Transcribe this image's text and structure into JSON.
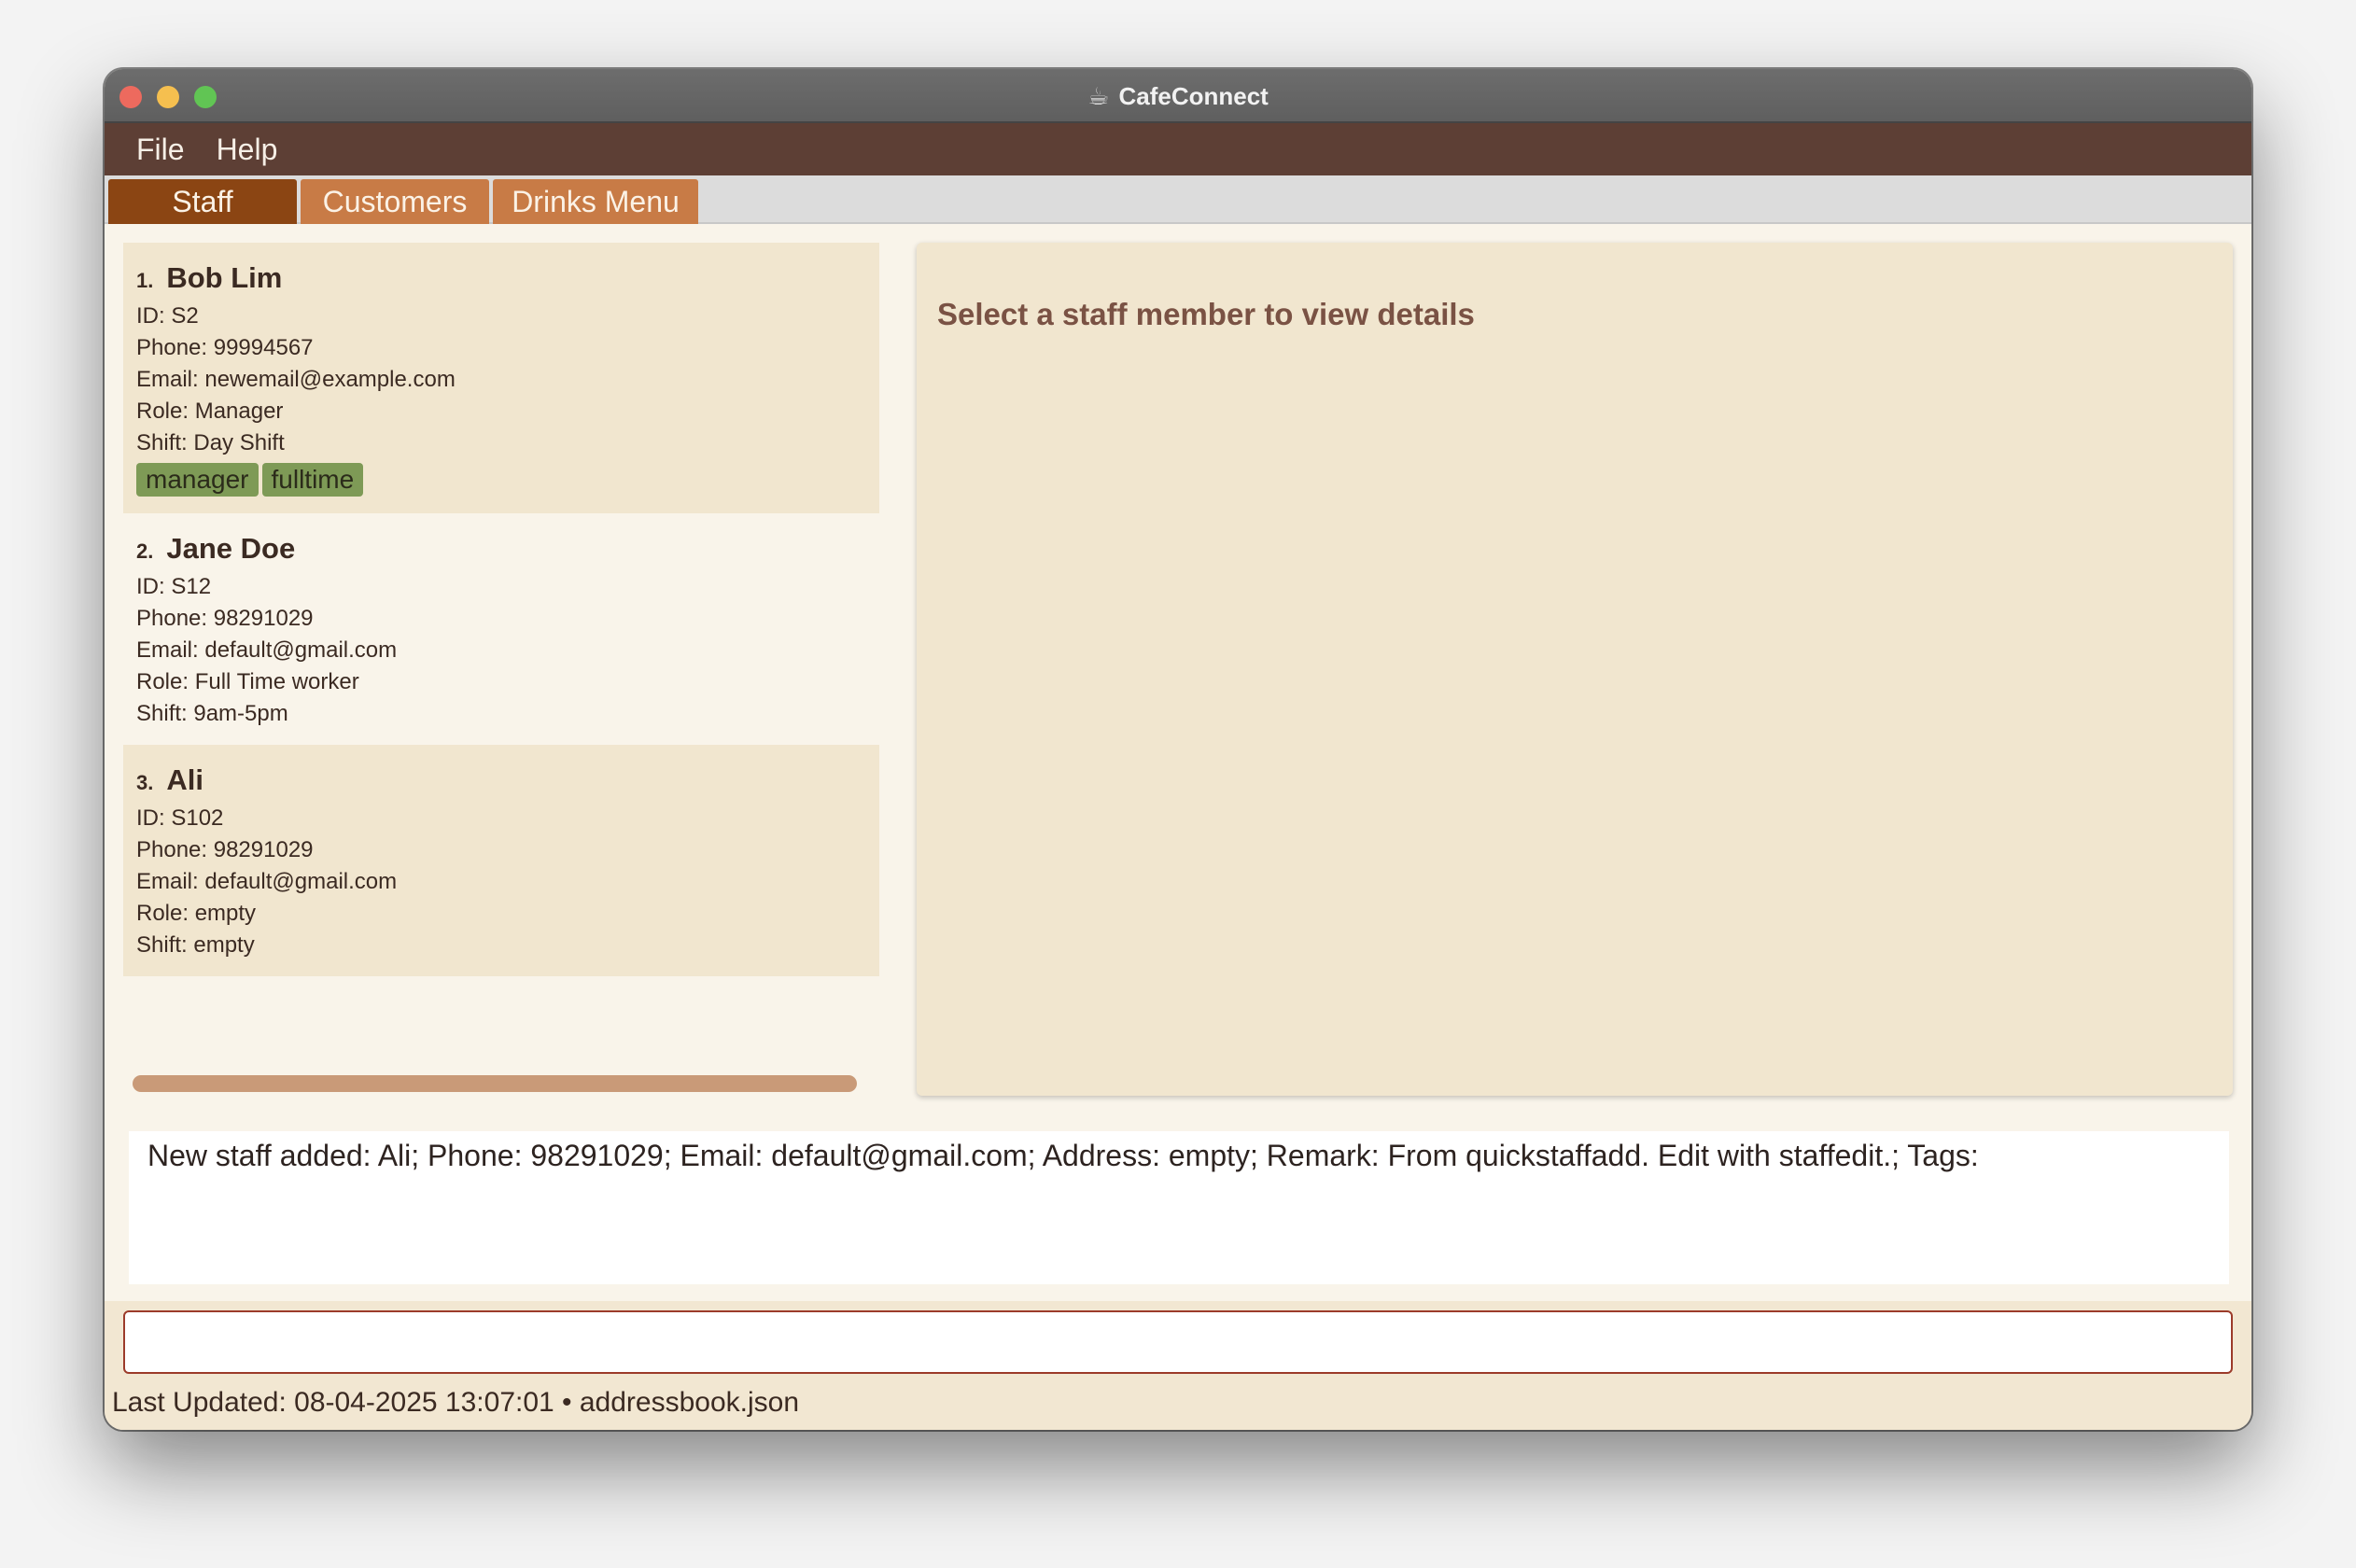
{
  "window": {
    "title": "CafeConnect",
    "title_icon": "coffee-cup-icon"
  },
  "menu": {
    "items": [
      "File",
      "Help"
    ]
  },
  "tabs": [
    {
      "label": "Staff",
      "active": true
    },
    {
      "label": "Customers",
      "active": false
    },
    {
      "label": "Drinks Menu",
      "active": false
    }
  ],
  "staff": [
    {
      "index": "1.",
      "name": "Bob Lim",
      "id": "ID: S2",
      "phone": "Phone: 99994567",
      "email": "Email: newemail@example.com",
      "role": "Role: Manager",
      "shift": "Shift: Day Shift",
      "tags": [
        "manager",
        "fulltime"
      ]
    },
    {
      "index": "2.",
      "name": "Jane Doe",
      "id": "ID: S12",
      "phone": "Phone: 98291029",
      "email": "Email: default@gmail.com",
      "role": "Role: Full Time worker",
      "shift": "Shift: 9am-5pm",
      "tags": []
    },
    {
      "index": "3.",
      "name": "Ali",
      "id": "ID: S102",
      "phone": "Phone: 98291029",
      "email": "Email: default@gmail.com",
      "role": "Role: empty",
      "shift": "Shift: empty",
      "tags": []
    }
  ],
  "detail": {
    "placeholder": "Select a staff member to view details"
  },
  "result": {
    "text": "New staff added: Ali; Phone: 98291029; Email: default@gmail.com; Address: empty; Remark: From quickstaffadd. Edit with staffedit.; Tags:"
  },
  "command": {
    "value": "",
    "placeholder": ""
  },
  "status": {
    "text": "Last Updated: 08-04-2025 13:07:01 • addressbook.json"
  },
  "colors": {
    "menubar": "#5d3f35",
    "tab_active": "#8b4513",
    "tab_inactive": "#c87b46",
    "card_alt": "#f1e6cf",
    "tag": "#7e9a56",
    "input_border": "#9c3b2a"
  }
}
